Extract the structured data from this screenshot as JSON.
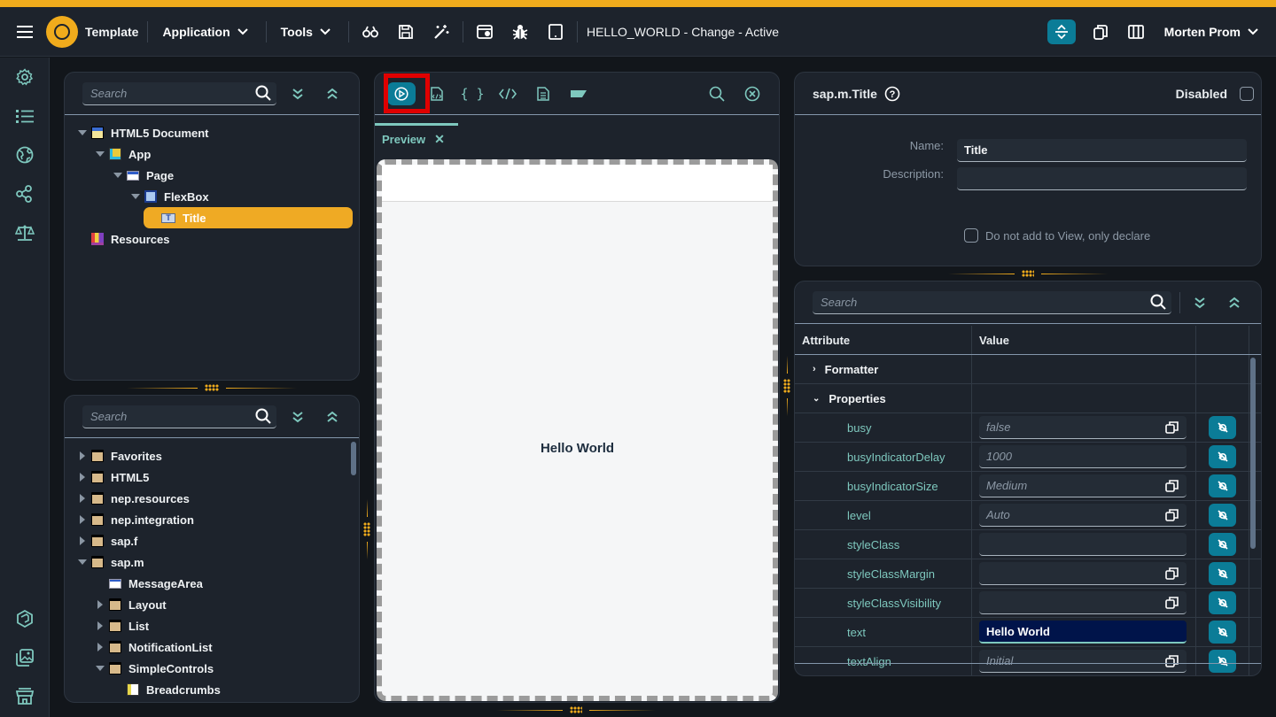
{
  "header": {
    "app_name": "Template",
    "menus": [
      {
        "label": "Application"
      },
      {
        "label": "Tools"
      }
    ],
    "window_title": "HELLO_WORLD - Change - Active",
    "user_name": "Morten Prom",
    "toolbar_icons": [
      "binoculars-icon",
      "save-icon",
      "magic-wand-icon",
      "browser-icon",
      "bug-icon",
      "tablet-icon"
    ],
    "right_icons": [
      "layout-toggle-icon",
      "copy-icon",
      "columns-icon"
    ]
  },
  "sidebar": {
    "top_icons": [
      "gear-icon",
      "list-icon",
      "globe-icon",
      "share-icon",
      "balance-scale-icon"
    ],
    "bottom_icons": [
      "package-icon",
      "image-gallery-icon",
      "store-icon"
    ]
  },
  "outline_panel": {
    "search_placeholder": "Search",
    "tree": [
      {
        "label": "HTML5 Document",
        "level": 0,
        "expanded": true
      },
      {
        "label": "App",
        "level": 1,
        "expanded": true
      },
      {
        "label": "Page",
        "level": 2,
        "expanded": true
      },
      {
        "label": "FlexBox",
        "level": 3,
        "expanded": true
      },
      {
        "label": "Title",
        "level": 4,
        "selected": true
      },
      {
        "label": "Resources",
        "level": 0
      }
    ]
  },
  "library_panel": {
    "search_placeholder": "Search",
    "tree": [
      {
        "label": "Favorites",
        "level": 0,
        "expanded": false
      },
      {
        "label": "HTML5",
        "level": 0,
        "expanded": false
      },
      {
        "label": "nep.resources",
        "level": 0,
        "expanded": false
      },
      {
        "label": "nep.integration",
        "level": 0,
        "expanded": false
      },
      {
        "label": "sap.f",
        "level": 0,
        "expanded": false
      },
      {
        "label": "sap.m",
        "level": 0,
        "expanded": true
      },
      {
        "label": "MessageArea",
        "level": 1
      },
      {
        "label": "Layout",
        "level": 1,
        "expanded": false
      },
      {
        "label": "List",
        "level": 1,
        "expanded": false
      },
      {
        "label": "NotificationList",
        "level": 1,
        "expanded": false
      },
      {
        "label": "SimpleControls",
        "level": 1,
        "expanded": true
      },
      {
        "label": "Breadcrumbs",
        "level": 2
      }
    ]
  },
  "editor_panel": {
    "toolbar_icons": [
      "run-preview-icon",
      "html-file-icon",
      "json-braces-icon",
      "code-icon",
      "document-icon",
      "tag-icon"
    ],
    "active_tool": "run-preview-icon",
    "tab_label": "Preview",
    "preview_text": "Hello World"
  },
  "properties_panel": {
    "control_type": "sap.m.Title",
    "disabled_label": "Disabled",
    "disabled_checked": false,
    "name_label": "Name:",
    "name_value": "Title",
    "description_label": "Description:",
    "description_value": "",
    "declare_only_label": "Do not add to View, only declare",
    "declare_only_checked": false
  },
  "attributes_panel": {
    "search_placeholder": "Search",
    "columns": {
      "attribute": "Attribute",
      "value": "Value"
    },
    "groups": [
      {
        "label": "Formatter",
        "expanded": false
      },
      {
        "label": "Properties",
        "expanded": true
      }
    ],
    "properties": [
      {
        "name": "busy",
        "placeholder": "false",
        "value": "",
        "has_picker": true
      },
      {
        "name": "busyIndicatorDelay",
        "placeholder": "1000",
        "value": "",
        "has_picker": false
      },
      {
        "name": "busyIndicatorSize",
        "placeholder": "Medium",
        "value": "",
        "has_picker": true
      },
      {
        "name": "level",
        "placeholder": "Auto",
        "value": "",
        "has_picker": true
      },
      {
        "name": "styleClass",
        "placeholder": "",
        "value": "",
        "has_picker": false
      },
      {
        "name": "styleClassMargin",
        "placeholder": "",
        "value": "",
        "has_picker": true
      },
      {
        "name": "styleClassVisibility",
        "placeholder": "",
        "value": "",
        "has_picker": true
      },
      {
        "name": "text",
        "placeholder": "",
        "value": "Hello World",
        "has_picker": false,
        "active": true
      },
      {
        "name": "textAlign",
        "placeholder": "Initial",
        "value": "",
        "has_picker": true
      }
    ]
  },
  "colors": {
    "accent": "#f0ab1c",
    "teal": "#7ec8be",
    "button": "#0b7c97",
    "background": "#1d232c"
  }
}
